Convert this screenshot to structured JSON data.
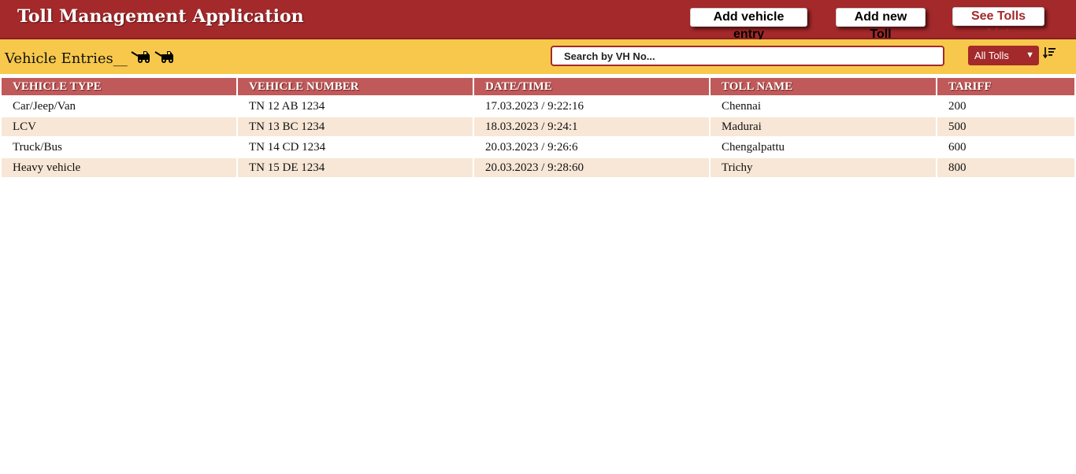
{
  "header": {
    "title": "Toll Management Application",
    "buttons": {
      "add_vehicle": "Add vehicle entry",
      "add_toll": "Add new Toll",
      "see_tolls": "See Tolls List"
    }
  },
  "toolbar": {
    "section_title": "Vehicle Entries__",
    "search_placeholder": "Search by VH No...",
    "filter_selected": "All Tolls"
  },
  "table": {
    "columns": [
      "VEHICLE TYPE",
      "VEHICLE NUMBER",
      "DATE/TIME",
      "TOLL NAME",
      "TARIFF"
    ],
    "rows": [
      [
        "Car/Jeep/Van",
        "TN 12 AB 1234",
        "17.03.2023 / 9:22:16",
        "Chennai",
        "200"
      ],
      [
        "LCV",
        "TN 13 BC 1234",
        "18.03.2023 / 9:24:1",
        "Madurai",
        "500"
      ],
      [
        "Truck/Bus",
        "TN 14 CD 1234",
        "20.03.2023 / 9:26:6",
        "Chengalpattu",
        "600"
      ],
      [
        "Heavy vehicle",
        "TN 15 DE 1234",
        "20.03.2023 / 9:28:60",
        "Trichy",
        "800"
      ]
    ]
  },
  "icons": {
    "truck": "tow-truck-icon",
    "sort": "sort-descending-icon"
  },
  "colors": {
    "header_bg": "#a3292b",
    "toolbar_bg": "#f7c84b",
    "table_header_bg": "#c05a5a",
    "row_alt_bg": "#f8e7d6"
  }
}
